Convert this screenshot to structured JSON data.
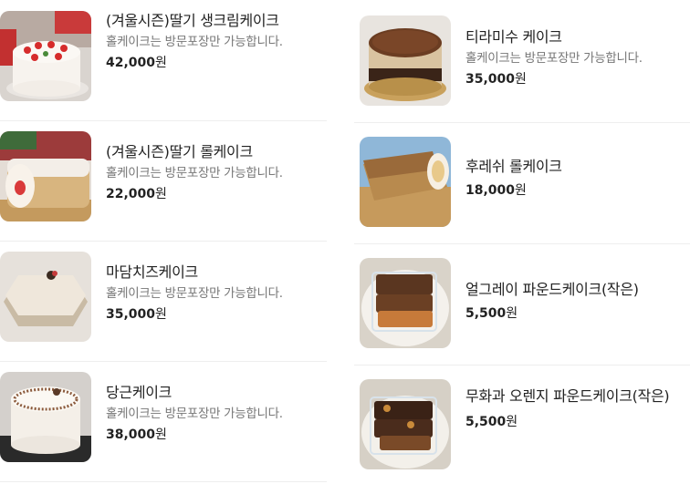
{
  "left_items": [
    {
      "name": "(겨울시즌)딸기 생크림케이크",
      "desc": "홀케이크는 방문포장만 가능합니다.",
      "price": "42,000",
      "unit": "원",
      "image": "strawberry-cream-cake"
    },
    {
      "name": "(겨울시즌)딸기 롤케이크",
      "desc": "홀케이크는 방문포장만 가능합니다.",
      "price": "22,000",
      "unit": "원",
      "image": "strawberry-roll-cake"
    },
    {
      "name": "마담치즈케이크",
      "desc": "홀케이크는 방문포장만 가능합니다.",
      "price": "35,000",
      "unit": "원",
      "image": "madame-cheese-cake"
    },
    {
      "name": "당근케이크",
      "desc": "홀케이크는 방문포장만 가능합니다.",
      "price": "38,000",
      "unit": "원",
      "image": "carrot-cake"
    }
  ],
  "right_items": [
    {
      "name": "티라미수 케이크",
      "desc": "홀케이크는 방문포장만 가능합니다.",
      "price": "35,000",
      "unit": "원",
      "image": "tiramisu-cake"
    },
    {
      "name": "후레쉬 롤케이크",
      "desc": "",
      "price": "18,000",
      "unit": "원",
      "image": "fresh-roll-cake"
    },
    {
      "name": "얼그레이 파운드케이크(작은)",
      "desc": "",
      "price": "5,500",
      "unit": "원",
      "image": "earl-grey-pound-cake"
    },
    {
      "name": "무화과 오렌지 파운드케이크(작은)",
      "desc": "",
      "price": "5,500",
      "unit": "원",
      "image": "fig-orange-pound-cake"
    }
  ]
}
